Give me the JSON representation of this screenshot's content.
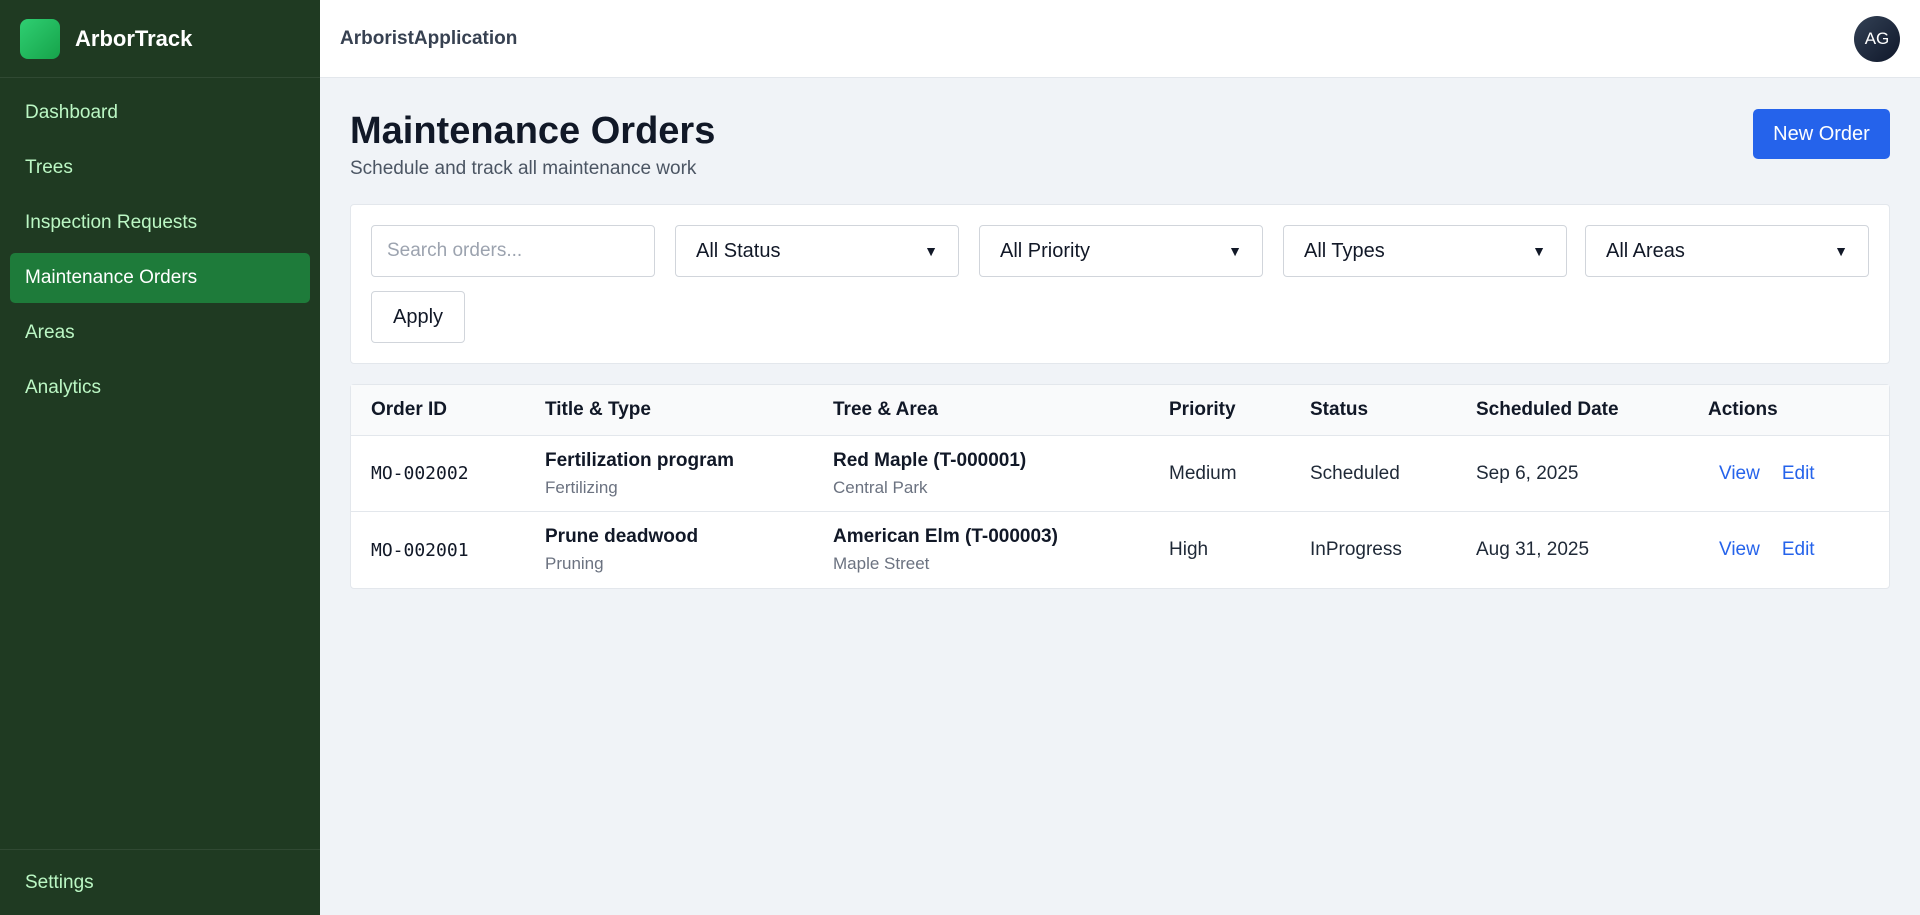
{
  "brand": {
    "name": "ArborTrack",
    "logo": "green-square-logo",
    "accent": "#22c55e"
  },
  "sidebar": {
    "items": [
      {
        "label": "Dashboard",
        "active": false
      },
      {
        "label": "Trees",
        "active": false
      },
      {
        "label": "Inspection Requests",
        "active": false
      },
      {
        "label": "Maintenance Orders",
        "active": true
      },
      {
        "label": "Areas",
        "active": false
      },
      {
        "label": "Analytics",
        "active": false
      }
    ],
    "footer_label": "Settings"
  },
  "topbar": {
    "app_name": "ArboristApplication",
    "avatar_initials": "AG"
  },
  "page": {
    "title": "Maintenance Orders",
    "subtitle": "Schedule and track all maintenance work",
    "new_button": "New Order"
  },
  "filters": {
    "search_placeholder": "Search orders...",
    "status": "All Status",
    "priority": "All Priority",
    "type": "All Types",
    "area": "All Areas",
    "apply_label": "Apply"
  },
  "table": {
    "headers": [
      "Order ID",
      "Title & Type",
      "Tree & Area",
      "Priority",
      "Status",
      "Scheduled Date",
      "Actions"
    ],
    "rows": [
      {
        "order_id": "MO-002002",
        "title": "Fertilization program",
        "type": "Fertilizing",
        "tree": "Red Maple (T-000001)",
        "area": "Central Park",
        "priority": "Medium",
        "status": "Scheduled",
        "date": "Sep 6, 2025",
        "view": "View",
        "edit": "Edit"
      },
      {
        "order_id": "MO-002001",
        "title": "Prune deadwood",
        "type": "Pruning",
        "tree": "American Elm (T-000003)",
        "area": "Maple Street",
        "priority": "High",
        "status": "InProgress",
        "date": "Aug 31, 2025",
        "view": "View",
        "edit": "Edit"
      }
    ]
  },
  "colors": {
    "sidebar_bg": "#1f3a22",
    "active_item": "#1e7b3a",
    "primary_button": "#2563eb",
    "link": "#2563eb"
  }
}
